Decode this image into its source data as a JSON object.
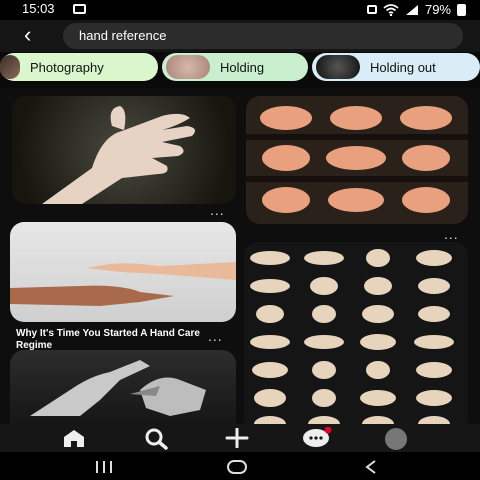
{
  "status": {
    "time": "15:03",
    "battery": "79%"
  },
  "search": {
    "query": "hand reference"
  },
  "chips": [
    {
      "label": "Photography"
    },
    {
      "label": "Holding"
    },
    {
      "label": "Holding out"
    }
  ],
  "feed": {
    "pin3_caption": "Why It's Time You Started A Hand Care Regime",
    "more_label": "..."
  },
  "icons": {
    "back": "arrow-left",
    "home": "home",
    "search": "search",
    "create": "plus",
    "messages": "chat",
    "profile": "avatar"
  },
  "colors": {
    "chip_green": "#d9f6cd",
    "chip_blue": "#d8edf6",
    "notification": "#e60023"
  }
}
